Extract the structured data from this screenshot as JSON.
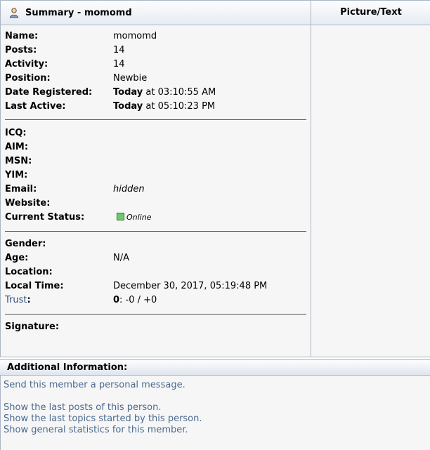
{
  "header": {
    "summary_title": "Summary - momomd",
    "picture_title": "Picture/Text"
  },
  "basic": [
    {
      "label": "Name:",
      "value": "momomd"
    },
    {
      "label": "Posts:",
      "value": "14"
    },
    {
      "label": "Activity:",
      "value": "14"
    },
    {
      "label": "Position:",
      "value": "Newbie"
    }
  ],
  "registered": {
    "label": "Date Registered:",
    "day": "Today",
    "time": " at 03:10:55 AM"
  },
  "last_active": {
    "label": "Last Active:",
    "day": "Today",
    "time": " at 05:10:23 PM"
  },
  "contact": {
    "icq_label": "ICQ:",
    "aim_label": "AIM:",
    "msn_label": "MSN:",
    "yim_label": "YIM:",
    "email_label": "Email:",
    "email_value": "hidden",
    "website_label": "Website:",
    "status_label": "Current Status:",
    "status_value": "Online"
  },
  "personal": {
    "gender_label": "Gender:",
    "age_label": "Age:",
    "age_value": "N/A",
    "location_label": "Location:",
    "localtime_label": "Local Time:",
    "localtime_value": "December 30, 2017, 05:19:48 PM",
    "trust_label": "Trust",
    "trust_colon": ":",
    "trust_score": "0",
    "trust_rest": ": -0 / +0"
  },
  "signature_label": "Signature:",
  "additional": {
    "title": "Additional Information:",
    "links": [
      "Send this member a personal message.",
      "Show the last posts of this person.",
      "Show the last topics started by this person.",
      "Show general statistics for this member."
    ]
  },
  "colors": {
    "link": "#4a6a8f",
    "border": "#aab5c4",
    "online": "#6ccc6c"
  }
}
